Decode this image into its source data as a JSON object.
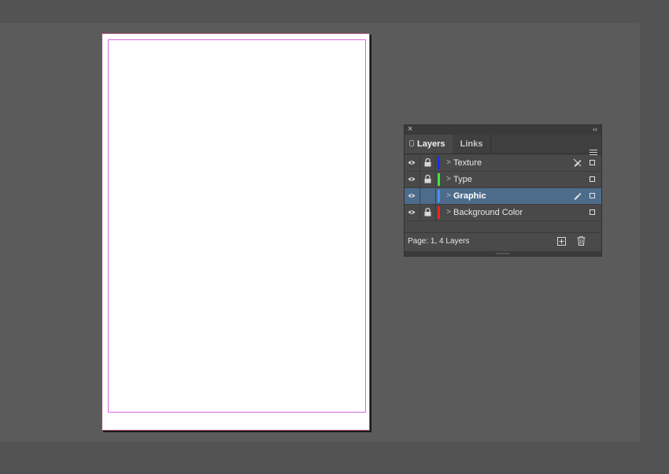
{
  "panel": {
    "close_glyph": "×",
    "collapse_glyph": "‹‹",
    "tabs": [
      {
        "label": "Layers",
        "active": true
      },
      {
        "label": "Links",
        "active": false
      }
    ],
    "menu_icon": "panel-menu-icon",
    "layers": [
      {
        "name": "Texture",
        "color": "#1a2cff",
        "visible": true,
        "locked": true,
        "selected": false,
        "pen_icon": "pen-crossed-icon"
      },
      {
        "name": "Type",
        "color": "#3ce83c",
        "visible": true,
        "locked": true,
        "selected": false,
        "pen_icon": ""
      },
      {
        "name": "Graphic",
        "color": "#4a8cff",
        "visible": true,
        "locked": false,
        "selected": true,
        "pen_icon": "pen-icon"
      },
      {
        "name": "Background Color",
        "color": "#ff2020",
        "visible": true,
        "locked": true,
        "selected": false,
        "pen_icon": ""
      }
    ],
    "footer": {
      "status": "Page: 1, 4 Layers",
      "new_layer_icon": "new-layer-icon",
      "delete_icon": "trash-icon"
    }
  },
  "colors": {
    "app_background": "#535353",
    "pasteboard": "#5b5b5b",
    "selection": "#4d6c8c",
    "page_border": "#a3486d",
    "margin_guide": "#d36ae0"
  }
}
